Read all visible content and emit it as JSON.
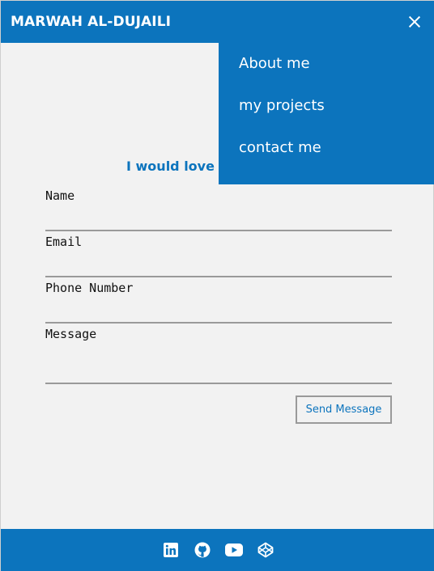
{
  "header": {
    "brand": "MARWAH AL-DUJAILI",
    "close_icon": "close-icon"
  },
  "menu": {
    "items": [
      {
        "label": "About me"
      },
      {
        "label": "my projects"
      },
      {
        "label": "contact me"
      }
    ]
  },
  "contact": {
    "subtitle": "I would love to",
    "fields": {
      "name_label": "Name",
      "email_label": "Email",
      "phone_label": "Phone Number",
      "message_label": "Message"
    },
    "send_label": "Send Message"
  },
  "footer": {
    "icons": [
      "linkedin-icon",
      "github-icon",
      "youtube-icon",
      "codepen-icon"
    ]
  },
  "colors": {
    "primary": "#0c74bd",
    "background": "#f2f2f2",
    "underline": "#9a9a9a"
  }
}
